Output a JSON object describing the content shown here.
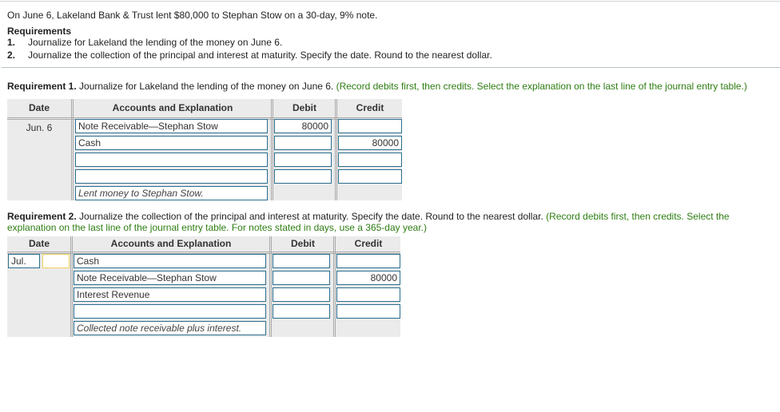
{
  "problem": "On June 6, Lakeland Bank & Trust lent $80,000 to Stephan Stow on a 30-day, 9% note.",
  "requirements": {
    "heading": "Requirements",
    "items": [
      {
        "num": "1.",
        "text": "Journalize for Lakeland the lending of the money on June 6."
      },
      {
        "num": "2.",
        "text": "Journalize the collection of the principal and interest at maturity. Specify the date. Round to the nearest dollar."
      }
    ]
  },
  "req1": {
    "label": "Requirement 1.",
    "text": " Journalize for Lakeland the lending of the money on June 6. ",
    "hint": "(Record debits first, then credits. Select the explanation on the last line of the journal entry table.)",
    "columns": [
      "Date",
      "Accounts and Explanation",
      "Debit",
      "Credit"
    ],
    "date": "Jun. 6",
    "rows": [
      {
        "account": "Note Receivable—Stephan Stow",
        "debit": "80000",
        "credit": ""
      },
      {
        "account": "Cash",
        "debit": "",
        "credit": "80000"
      },
      {
        "account": "",
        "debit": "",
        "credit": ""
      },
      {
        "account": "",
        "debit": "",
        "credit": ""
      }
    ],
    "explanation": "Lent money to Stephan Stow."
  },
  "req2": {
    "label": "Requirement 2.",
    "text": " Journalize the collection of the principal and interest at maturity. Specify the date. Round to the nearest dollar. ",
    "hint": "(Record debits first, then credits. Select the explanation on the last line of the journal entry table. For notes stated in days, use a 365-day year.)",
    "columns": [
      "Date",
      "Accounts and Explanation",
      "Debit",
      "Credit"
    ],
    "date_month": "Jul.",
    "date_day": "",
    "rows": [
      {
        "account": "Cash",
        "debit": "",
        "credit": ""
      },
      {
        "account": "Note Receivable—Stephan Stow",
        "debit": "",
        "credit": "80000"
      },
      {
        "account": "Interest Revenue",
        "debit": "",
        "credit": ""
      },
      {
        "account": "",
        "debit": "",
        "credit": ""
      }
    ],
    "explanation": "Collected note receivable plus interest."
  }
}
